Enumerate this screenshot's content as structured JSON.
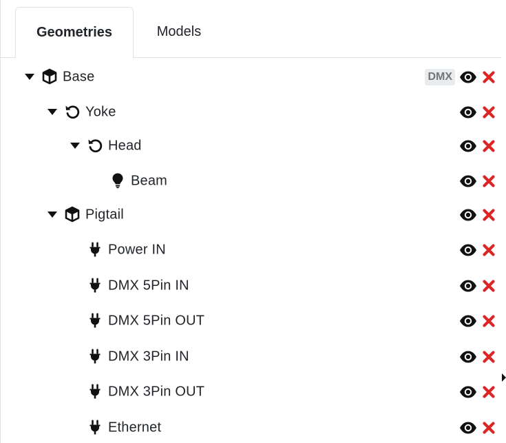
{
  "tabs": [
    {
      "label": "Geometries",
      "active": true
    },
    {
      "label": "Models",
      "active": false
    }
  ],
  "tree": [
    {
      "label": "Base",
      "icon": "cube-icon",
      "level": 0,
      "expandable": true,
      "badge": "DMX"
    },
    {
      "label": "Yoke",
      "icon": "rotate-icon",
      "level": 1,
      "expandable": true
    },
    {
      "label": "Head",
      "icon": "rotate-icon",
      "level": 2,
      "expandable": true
    },
    {
      "label": "Beam",
      "icon": "lightbulb-icon",
      "level": 3,
      "expandable": false
    },
    {
      "label": "Pigtail",
      "icon": "cube-icon",
      "level": 1,
      "expandable": true
    },
    {
      "label": "Power IN",
      "icon": "plug-icon",
      "level": 2,
      "expandable": false
    },
    {
      "label": "DMX 5Pin IN",
      "icon": "plug-icon",
      "level": 2,
      "expandable": false
    },
    {
      "label": "DMX 5Pin OUT",
      "icon": "plug-icon",
      "level": 2,
      "expandable": false
    },
    {
      "label": "DMX 3Pin IN",
      "icon": "plug-icon",
      "level": 2,
      "expandable": false
    },
    {
      "label": "DMX 3Pin OUT",
      "icon": "plug-icon",
      "level": 2,
      "expandable": false
    },
    {
      "label": "Ethernet",
      "icon": "plug-icon",
      "level": 2,
      "expandable": false
    }
  ],
  "colors": {
    "delete": "#dc2626",
    "icon": "#111111",
    "badge_text": "#757575",
    "badge_bg": "#e9ecef"
  }
}
